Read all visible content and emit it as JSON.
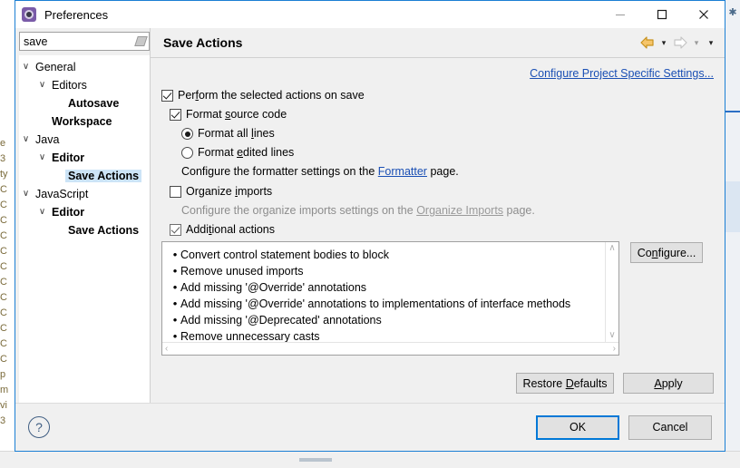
{
  "window": {
    "title": "Preferences",
    "icon": "preferences-gear-icon",
    "controls": {
      "minimize": "—",
      "maximize": "□",
      "close": "✕"
    }
  },
  "search": {
    "value": "save",
    "placeholder": "type filter text",
    "clear_icon": "eraser-icon"
  },
  "tree": {
    "items": [
      {
        "label": "General",
        "indent": 0,
        "arrow": "∨",
        "bold": false,
        "selected": false
      },
      {
        "label": "Editors",
        "indent": 1,
        "arrow": "∨",
        "bold": false,
        "selected": false
      },
      {
        "label": "Autosave",
        "indent": 2,
        "arrow": "",
        "bold": true,
        "selected": false
      },
      {
        "label": "Workspace",
        "indent": 1,
        "arrow": "",
        "bold": true,
        "selected": false
      },
      {
        "label": "Java",
        "indent": 0,
        "arrow": "∨",
        "bold": false,
        "selected": false
      },
      {
        "label": "Editor",
        "indent": 1,
        "arrow": "∨",
        "bold": true,
        "selected": false
      },
      {
        "label": "Save Actions",
        "indent": 2,
        "arrow": "",
        "bold": true,
        "selected": true
      },
      {
        "label": "JavaScript",
        "indent": 0,
        "arrow": "∨",
        "bold": false,
        "selected": false
      },
      {
        "label": "Editor",
        "indent": 1,
        "arrow": "∨",
        "bold": true,
        "selected": false
      },
      {
        "label": "Save Actions",
        "indent": 2,
        "arrow": "",
        "bold": true,
        "selected": false
      }
    ]
  },
  "page": {
    "title": "Save Actions",
    "nav": {
      "back_icon": "back-arrow-icon",
      "back_caret": "▾",
      "forward_icon": "forward-arrow-icon",
      "forward_caret": "▾",
      "menu_caret": "▾"
    },
    "project_settings_link": "Configure Project Specific Settings...",
    "perform_actions": {
      "label_before": "Per",
      "label_mnemonic": "f",
      "label_after": "orm the selected actions on save",
      "checked": true
    },
    "format_source": {
      "label_before": "Format ",
      "label_mnemonic": "s",
      "label_after": "ource code",
      "checked": true
    },
    "format_all_lines": {
      "label_before": "Format all ",
      "label_mnemonic": "l",
      "label_after": "ines",
      "selected": true
    },
    "format_edited_lines": {
      "label_before": "Format ",
      "label_mnemonic": "e",
      "label_after": "dited lines",
      "selected": false
    },
    "formatter_hint": {
      "prefix": "Configure the formatter settings on the ",
      "link": "Formatter",
      "suffix": " page."
    },
    "organize_imports": {
      "label_before": "Organize ",
      "label_mnemonic": "i",
      "label_after": "mports",
      "checked": false
    },
    "organize_hint": {
      "prefix": "Configure the organize imports settings on the ",
      "link": "Organize Imports",
      "suffix": " page."
    },
    "additional_actions": {
      "label_before": "Addi",
      "label_mnemonic": "t",
      "label_after": "ional actions",
      "checked": true
    },
    "actions_list": [
      "Convert control statement bodies to block",
      "Remove unused imports",
      "Add missing '@Override' annotations",
      "Add missing '@Override' annotations to implementations of interface methods",
      "Add missing '@Deprecated' annotations",
      "Remove unnecessary casts"
    ],
    "scroll": {
      "up": "∧",
      "down": "∨",
      "left": "‹",
      "right": "›"
    },
    "configure_button": {
      "before": "Co",
      "mnemonic": "n",
      "after": "figure..."
    },
    "restore_defaults_button": {
      "before": "Restore ",
      "mnemonic": "D",
      "after": "efaults"
    },
    "apply_button": {
      "before": "",
      "mnemonic": "A",
      "after": "pply"
    }
  },
  "footer": {
    "help_icon": "question-mark-icon",
    "help_glyph": "?",
    "ok_label": "OK",
    "cancel_label": "Cancel"
  },
  "background": {
    "left_gutter_text": "e\n3\nty\nC\nC\nC\nC\nC\nC\nC\nC\nC\nC\nC\nC\np\nm\nvi\n3",
    "right_icon": "bg-marker-icon"
  },
  "colors": {
    "accent": "#0078d7",
    "link": "#1a4fb4",
    "selection": "#cce4f7",
    "disabled_text": "#8d8d8d",
    "back_arrow": "#e8a33d",
    "dialog_border": "#1b7fd4"
  }
}
